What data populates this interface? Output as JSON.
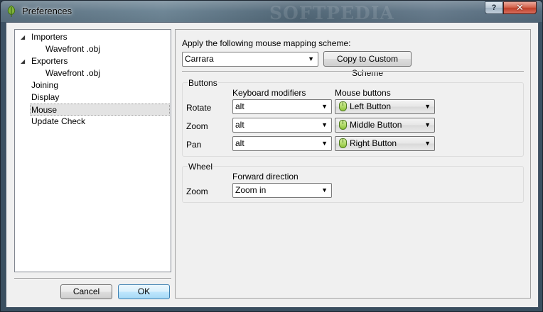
{
  "window": {
    "title": "Preferences",
    "watermark": "SOFTPEDIA",
    "help_label": "?",
    "close_label": "✕"
  },
  "tree": {
    "items": [
      {
        "label": "Importers",
        "expanded": true
      },
      {
        "label": "Wavefront .obj"
      },
      {
        "label": "Exporters",
        "expanded": true
      },
      {
        "label": "Wavefront .obj"
      },
      {
        "label": "Joining"
      },
      {
        "label": "Display"
      },
      {
        "label": "Mouse",
        "selected": true
      },
      {
        "label": "Update Check"
      }
    ]
  },
  "dialog_buttons": {
    "cancel": "Cancel",
    "ok": "OK"
  },
  "mapping": {
    "prompt": "Apply the following mouse mapping scheme:",
    "scheme": "Carrara",
    "copy_button": "Copy to Custom Scheme"
  },
  "buttons_group": {
    "title": "Buttons",
    "modifiers_header": "Keyboard modifiers",
    "mouse_header": "Mouse buttons",
    "rows": [
      {
        "label": "Rotate",
        "modifier": "alt",
        "button": "Left Button"
      },
      {
        "label": "Zoom",
        "modifier": "alt",
        "button": "Middle Button"
      },
      {
        "label": "Pan",
        "modifier": "alt",
        "button": "Right Button"
      }
    ]
  },
  "wheel_group": {
    "title": "Wheel",
    "direction_header": "Forward direction",
    "row_label": "Zoom",
    "direction": "Zoom in"
  },
  "colors": {
    "title_bar": "#5a7080",
    "close_button": "#c0402a",
    "selection": "#e3e3e3",
    "mouse_icon": "#8fc53a"
  }
}
